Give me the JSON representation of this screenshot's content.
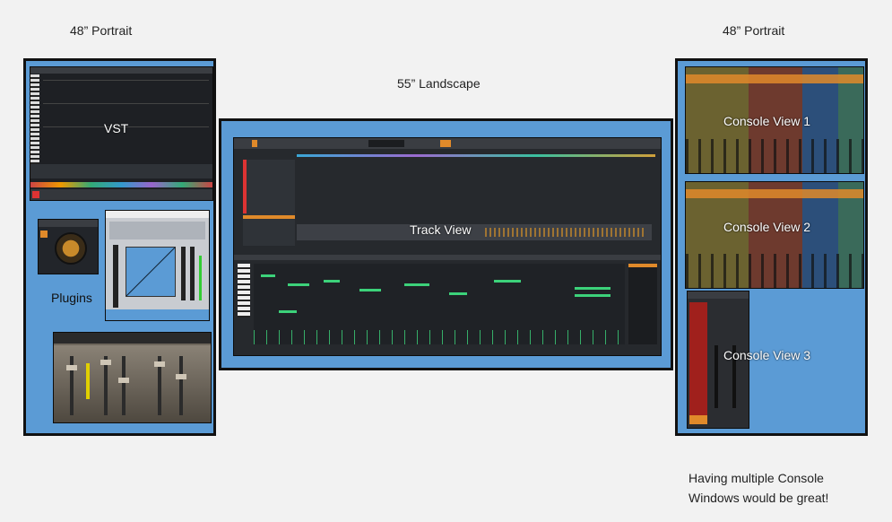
{
  "labels": {
    "left_title": "48” Portrait",
    "center_title": "55” Landscape",
    "right_title": "48” Portrait",
    "note_line1": "Having multiple Console",
    "note_line2": "Windows would be great!"
  },
  "left_panel": {
    "vst_label": "VST",
    "plugins_label": "Plugins"
  },
  "center_panel": {
    "track_view_label": "Track View"
  },
  "right_panel": {
    "console1_label": "Console View 1",
    "console2_label": "Console View 2",
    "console3_label": "Console View 3"
  },
  "colors": {
    "background": "#f2f2f2",
    "panel_blue": "#5b9bd5",
    "panel_border": "#111111",
    "daw_dark": "#2a2d31",
    "midi_green": "#3cd27a",
    "accent_orange": "#e08a2a"
  }
}
